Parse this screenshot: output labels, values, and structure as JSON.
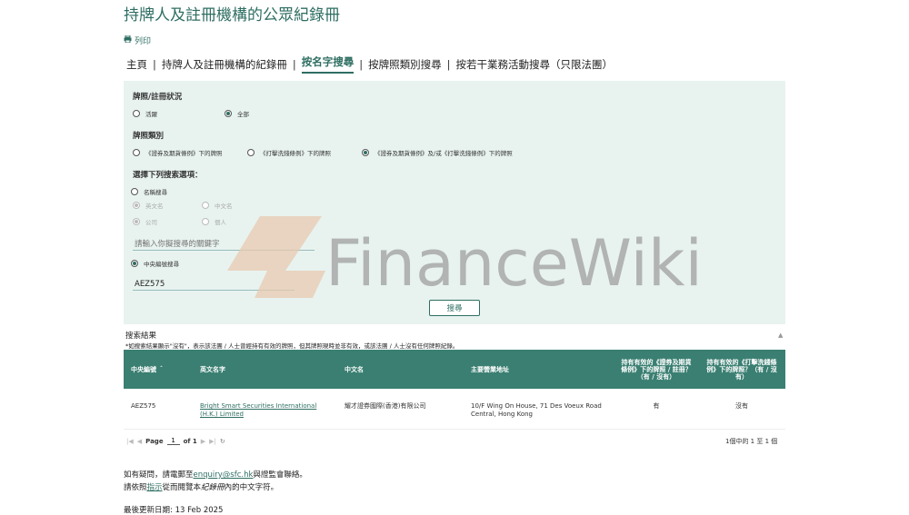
{
  "page": {
    "title": "持牌人及註冊機構的公眾紀錄冊",
    "print_label": "列印"
  },
  "nav": {
    "items": [
      {
        "label": "主頁"
      },
      {
        "label": "持牌人及註冊機構的紀錄冊"
      },
      {
        "label": "按名字搜尋",
        "active": true
      },
      {
        "label": "按牌照類別搜尋"
      },
      {
        "label": "按若干業務活動搜尋（只限法團）"
      }
    ]
  },
  "filters": {
    "status_label": "牌照/註冊狀況",
    "status_options": [
      "活躍",
      "全部"
    ],
    "status_selected": "全部",
    "license_label": "牌照類別",
    "license_options": [
      "《證券及期貨條例》下的牌照",
      "《打擊洗錢條例》下的牌照",
      "《證券及期貨條例》及/或《打擊洗錢條例》下的牌照"
    ],
    "license_selected": 2,
    "search_option_label": "選擇下列搜索選項：",
    "name_search_label": "名稱搜尋",
    "english_name": "英文名",
    "chinese_name": "中文名",
    "company": "公司",
    "individual": "個人",
    "keyword_placeholder": "請輸入你擬搜尋的關鍵字",
    "ce_search_label": "中央編號搜尋",
    "ce_value": "AEZ575",
    "search_button": "搜尋"
  },
  "results": {
    "title": "搜索結果",
    "note": "*如搜索結果顯示\"沒有\"，表示該法團 / 人士曾經持有有效的牌照，但其牌照現時並非有效，或該法團 / 人士沒有任何牌照紀錄。",
    "columns": [
      "中央編號",
      "英文名字",
      "中文名",
      "主要營業地址",
      "持有有效的《證券及期貨條例》下的牌照 / 註冊？（有 / 沒有）",
      "持有有效的《打擊洗錢條例》下的牌照？（有 / 沒有）"
    ],
    "rows": [
      {
        "ce": "AEZ575",
        "english_name": "Bright Smart Securities International (H.K.) Limited",
        "chinese_name": "耀才證券國際(香港)有限公司",
        "address": "10/F Wing On House, 71 Des Voeux Road Central, Hong Kong",
        "sfo": "有",
        "amlo": "沒有"
      }
    ],
    "pager": {
      "page_label": "Page",
      "page_value": "1",
      "of_label": "of 1"
    },
    "count_text": "1個中的 1 至 1 個"
  },
  "footer": {
    "contact_prefix": "如有疑問，請電郵至",
    "email": "enquiry@sfc.hk",
    "contact_suffix": "與證監會聯絡。",
    "guide_prefix": "請依照",
    "guide_link": "指示",
    "guide_middle": "從而閱覽本",
    "guide_italic": "紀錄冊",
    "guide_suffix": "內的中文字符。",
    "updated": "最後更新日期: 13 Feb 2025"
  },
  "watermark": {
    "text": "FinanceWiki"
  },
  "colors": {
    "accent": "#2e6e62",
    "panel": "#e8f3f0",
    "header": "#3a7f72"
  }
}
